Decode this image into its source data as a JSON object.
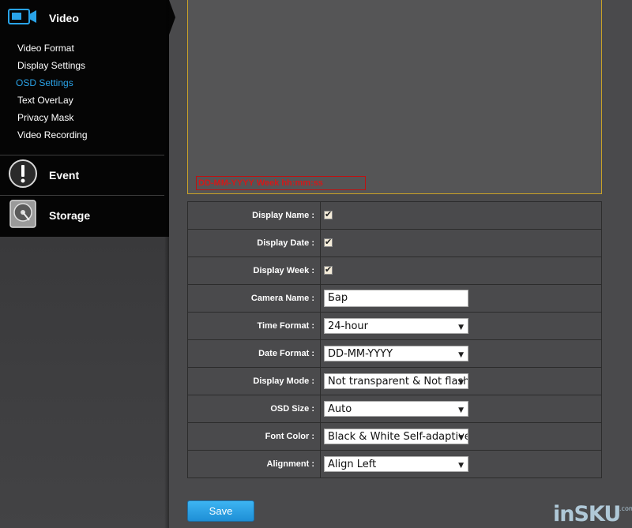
{
  "sidebar": {
    "video": {
      "label": "Video",
      "icon": "video-camera-icon"
    },
    "video_items": [
      {
        "label": "Video Format"
      },
      {
        "label": "Display Settings"
      },
      {
        "label": "OSD Settings",
        "active": true
      },
      {
        "label": "Text OverLay"
      },
      {
        "label": "Privacy Mask"
      },
      {
        "label": "Video Recording"
      }
    ],
    "event": {
      "label": "Event",
      "icon": "exclamation-icon"
    },
    "storage": {
      "label": "Storage",
      "icon": "disk-icon"
    },
    "active_color": "#2aa3e8"
  },
  "preview": {
    "osd_text": "DD-MM-YYYY Week hh:mm:ss",
    "osd_color": "#d11a1a",
    "border_color": "#c9a227"
  },
  "settings": {
    "display_name": {
      "label": "Display Name :",
      "checked": true
    },
    "display_date": {
      "label": "Display Date :",
      "checked": true
    },
    "display_week": {
      "label": "Display Week :",
      "checked": true
    },
    "camera_name": {
      "label": "Camera Name :",
      "value": "Бар"
    },
    "time_format": {
      "label": "Time Format :",
      "value": "24-hour"
    },
    "date_format": {
      "label": "Date Format :",
      "value": "DD-MM-YYYY"
    },
    "display_mode": {
      "label": "Display Mode :",
      "value": "Not transparent & Not flashing"
    },
    "osd_size": {
      "label": "OSD Size :",
      "value": "Auto"
    },
    "font_color": {
      "label": "Font Color :",
      "value": "Black & White Self-adaptive"
    },
    "alignment": {
      "label": "Alignment :",
      "value": "Align Left"
    },
    "checkmark": "✔",
    "caret": "▼"
  },
  "save_label": "Save",
  "watermark": {
    "text": "inSKU",
    "domain": ".com"
  }
}
